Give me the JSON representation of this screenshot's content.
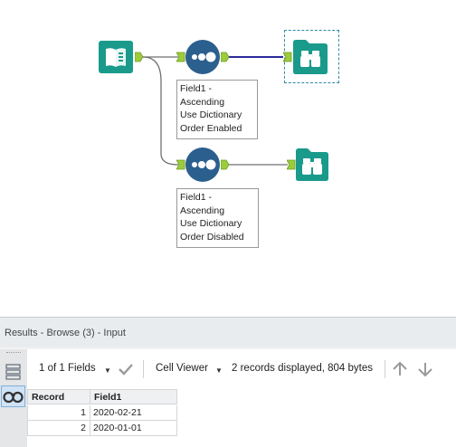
{
  "workflow": {
    "annotations": [
      {
        "lines": [
          "Field1 -",
          "Ascending",
          "Use Dictionary",
          "Order Enabled"
        ]
      },
      {
        "lines": [
          "Field1 -",
          "Ascending",
          "Use Dictionary",
          "Order Disabled"
        ]
      }
    ],
    "colors": {
      "input_tool": "#1a9a8b",
      "sort_tool": "#2b5f8e",
      "browse_tool": "#1a9a8b",
      "connector": "#9ccc3c",
      "selected_connection": "#2a2a9a",
      "connection": "#6f6f6f"
    }
  },
  "results": {
    "title": "Results - Browse (3) - Input",
    "fields_selector": "1 of 1 Fields",
    "viewer_selector": "Cell Viewer",
    "status": "2 records displayed, 804 bytes",
    "columns": [
      "Record",
      "Field1"
    ],
    "rows": [
      {
        "record": "1",
        "field1": "2020-02-21"
      },
      {
        "record": "2",
        "field1": "2020-01-01"
      }
    ]
  },
  "icons": [
    "input-data-icon",
    "sort-icon",
    "browse-icon",
    "checkmark-icon",
    "chevron-down-icon",
    "arrow-up-icon",
    "arrow-down-icon",
    "binoculars-icon",
    "field-list-icon"
  ]
}
